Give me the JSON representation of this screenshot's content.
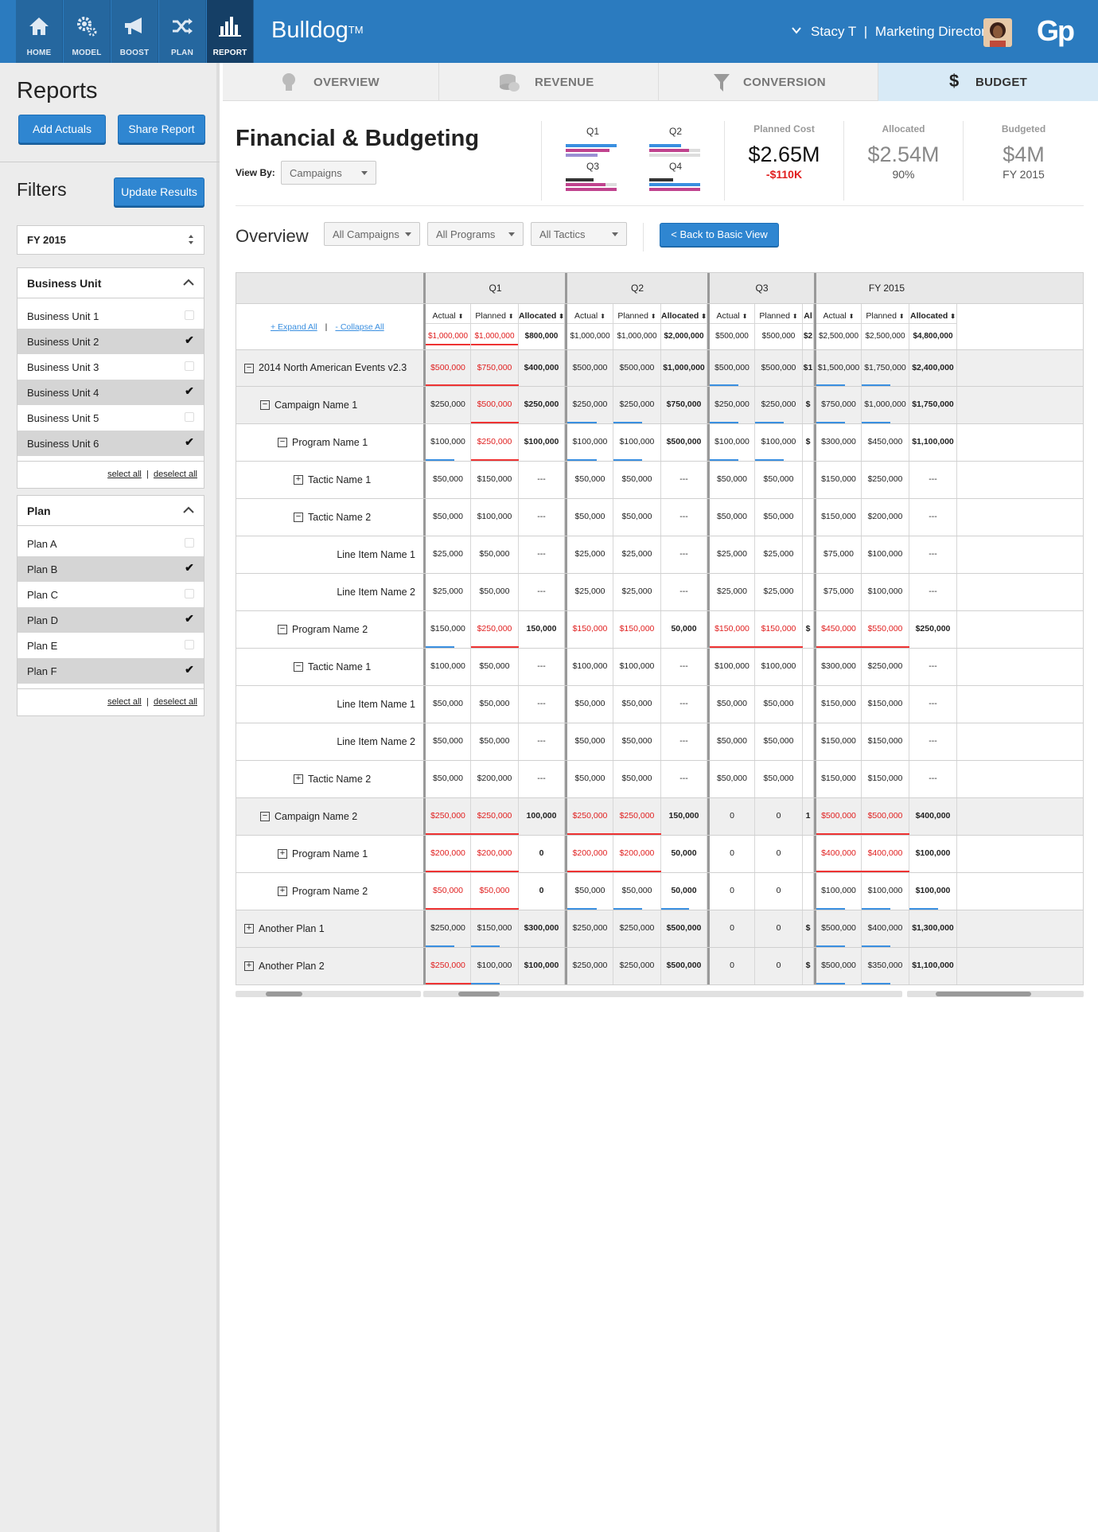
{
  "nav": {
    "items": [
      {
        "label": "HOME",
        "icon": "home-icon"
      },
      {
        "label": "MODEL",
        "icon": "gears-icon"
      },
      {
        "label": "BOOST",
        "icon": "megaphone-icon"
      },
      {
        "label": "PLAN",
        "icon": "shuffle-icon"
      },
      {
        "label": "REPORT",
        "icon": "bar-chart-icon",
        "active": true
      }
    ],
    "brand": "Bulldog",
    "brand_mark": "TM",
    "user_name": "Stacy T",
    "user_sep": "|",
    "user_role": "Marketing Director",
    "logo": "Gp"
  },
  "sidebar": {
    "reports_title": "Reports",
    "add_actuals": "Add Actuals",
    "share_report": "Share Report",
    "filters_title": "Filters",
    "update_results": "Update Results",
    "fiscal_year": "FY 2015",
    "business_unit": {
      "title": "Business Unit",
      "items": [
        {
          "label": "Business Unit 1",
          "checked": false
        },
        {
          "label": "Business Unit 2",
          "checked": true
        },
        {
          "label": "Business Unit 3",
          "checked": false
        },
        {
          "label": "Business Unit 4",
          "checked": true
        },
        {
          "label": "Business Unit 5",
          "checked": false
        },
        {
          "label": "Business Unit 6",
          "checked": true
        }
      ],
      "select_all": "select all",
      "deselect_all": "deselect all"
    },
    "plan": {
      "title": "Plan",
      "items": [
        {
          "label": "Plan A",
          "checked": false
        },
        {
          "label": "Plan B",
          "checked": true
        },
        {
          "label": "Plan C",
          "checked": false
        },
        {
          "label": "Plan D",
          "checked": true
        },
        {
          "label": "Plan E",
          "checked": false
        },
        {
          "label": "Plan F",
          "checked": true
        }
      ],
      "select_all": "select all",
      "deselect_all": "deselect all"
    }
  },
  "tabs": [
    {
      "label": "OVERVIEW",
      "icon": "lightbulb-icon"
    },
    {
      "label": "REVENUE",
      "icon": "coins-icon"
    },
    {
      "label": "CONVERSION",
      "icon": "funnel-icon"
    },
    {
      "label": "BUDGET",
      "icon": "dollar-icon",
      "active": true
    }
  ],
  "header": {
    "title": "Financial & Budgeting",
    "view_by_label": "View By:",
    "view_by_value": "Campaigns",
    "quarters": [
      "Q1",
      "Q2",
      "Q3",
      "Q4"
    ],
    "kpis": [
      {
        "label": "Planned Cost",
        "value": "$2.65M",
        "sub": "-$110K"
      },
      {
        "label": "Allocated",
        "value": "$2.54M",
        "sub": "90%"
      },
      {
        "label": "Budgeted",
        "value": "$4M",
        "sub": "FY 2015"
      }
    ]
  },
  "overview": {
    "title": "Overview",
    "campaigns": "All Campaigns",
    "programs": "All Programs",
    "tactics": "All Tactics",
    "back_button": "< Back to Basic View"
  },
  "table": {
    "expand_all": "+ Expand All",
    "collapse_all": "- Collapse All",
    "sep": "|",
    "groups": [
      "Q1",
      "Q2",
      "Q3",
      "FY 2015"
    ],
    "cols": [
      "Actual",
      "Planned",
      "Allocated",
      "Actual",
      "Planned",
      "Allocated",
      "Actual",
      "Planned",
      "Al",
      "Actual",
      "Planned",
      "Allocated"
    ],
    "totals": [
      "$1,000,000",
      "$1,000,000",
      "$800,000",
      "$1,000,000",
      "$1,000,000",
      "$2,000,000",
      "$500,000",
      "$500,000",
      "$2",
      "$2,500,000",
      "$2,500,000",
      "$4,800,000"
    ],
    "rows": [
      {
        "name": "2014 North American Events v2.3",
        "level": 0,
        "toggle": "−",
        "vals": [
          "$500,000",
          "$750,000",
          "$400,000",
          "$500,000",
          "$500,000",
          "$1,000,000",
          "$500,000",
          "$500,000",
          "$1",
          "$1,500,000",
          "$1,750,000",
          "$2,400,000"
        ]
      },
      {
        "name": "Campaign Name 1",
        "level": 1,
        "toggle": "−",
        "vals": [
          "$250,000",
          "$500,000",
          "$250,000",
          "$250,000",
          "$250,000",
          "$750,000",
          "$250,000",
          "$250,000",
          "$",
          "$750,000",
          "$1,000,000",
          "$1,750,000"
        ]
      },
      {
        "name": "Program Name 1",
        "level": 2,
        "toggle": "−",
        "vals": [
          "$100,000",
          "$250,000",
          "$100,000",
          "$100,000",
          "$100,000",
          "$500,000",
          "$100,000",
          "$100,000",
          "$",
          "$300,000",
          "$450,000",
          "$1,100,000"
        ]
      },
      {
        "name": "Tactic Name 1",
        "level": 3,
        "toggle": "+",
        "vals": [
          "$50,000",
          "$150,000",
          "---",
          "$50,000",
          "$50,000",
          "---",
          "$50,000",
          "$50,000",
          "",
          "$150,000",
          "$250,000",
          "---"
        ]
      },
      {
        "name": "Tactic Name 2",
        "level": 3,
        "toggle": "−",
        "vals": [
          "$50,000",
          "$100,000",
          "---",
          "$50,000",
          "$50,000",
          "---",
          "$50,000",
          "$50,000",
          "",
          "$150,000",
          "$200,000",
          "---"
        ]
      },
      {
        "name": "Line Item Name 1",
        "level": 4,
        "toggle": "",
        "vals": [
          "$25,000",
          "$50,000",
          "---",
          "$25,000",
          "$25,000",
          "---",
          "$25,000",
          "$25,000",
          "",
          "$75,000",
          "$100,000",
          "---"
        ]
      },
      {
        "name": "Line Item Name 2",
        "level": 4,
        "toggle": "",
        "vals": [
          "$25,000",
          "$50,000",
          "---",
          "$25,000",
          "$25,000",
          "---",
          "$25,000",
          "$25,000",
          "",
          "$75,000",
          "$100,000",
          "---"
        ]
      },
      {
        "name": "Program Name 2",
        "level": 2,
        "toggle": "−",
        "vals": [
          "$150,000",
          "$250,000",
          "150,000",
          "$150,000",
          "$150,000",
          "50,000",
          "$150,000",
          "$150,000",
          "$",
          "$450,000",
          "$550,000",
          "$250,000"
        ]
      },
      {
        "name": "Tactic Name 1",
        "level": 3,
        "toggle": "−",
        "vals": [
          "$100,000",
          "$50,000",
          "---",
          "$100,000",
          "$100,000",
          "---",
          "$100,000",
          "$100,000",
          "",
          "$300,000",
          "$250,000",
          "---"
        ]
      },
      {
        "name": "Line Item Name 1",
        "level": 4,
        "toggle": "",
        "vals": [
          "$50,000",
          "$50,000",
          "---",
          "$50,000",
          "$50,000",
          "---",
          "$50,000",
          "$50,000",
          "",
          "$150,000",
          "$150,000",
          "---"
        ]
      },
      {
        "name": "Line Item Name 2",
        "level": 4,
        "toggle": "",
        "vals": [
          "$50,000",
          "$50,000",
          "---",
          "$50,000",
          "$50,000",
          "---",
          "$50,000",
          "$50,000",
          "",
          "$150,000",
          "$150,000",
          "---"
        ]
      },
      {
        "name": "Tactic Name 2",
        "level": 3,
        "toggle": "+",
        "vals": [
          "$50,000",
          "$200,000",
          "---",
          "$50,000",
          "$50,000",
          "---",
          "$50,000",
          "$50,000",
          "",
          "$150,000",
          "$150,000",
          "---"
        ]
      },
      {
        "name": "Campaign Name 2",
        "level": 1,
        "toggle": "−",
        "vals": [
          "$250,000",
          "$250,000",
          "100,000",
          "$250,000",
          "$250,000",
          "150,000",
          "0",
          "0",
          "1",
          "$500,000",
          "$500,000",
          "$400,000"
        ]
      },
      {
        "name": "Program Name 1",
        "level": 2,
        "toggle": "+",
        "vals": [
          "$200,000",
          "$200,000",
          "0",
          "$200,000",
          "$200,000",
          "50,000",
          "0",
          "0",
          "",
          "$400,000",
          "$400,000",
          "$100,000"
        ]
      },
      {
        "name": "Program Name 2",
        "level": 2,
        "toggle": "+",
        "vals": [
          "$50,000",
          "$50,000",
          "0",
          "$50,000",
          "$50,000",
          "50,000",
          "0",
          "0",
          "",
          "$100,000",
          "$100,000",
          "$100,000"
        ]
      },
      {
        "name": "Another Plan 1",
        "level": 0,
        "toggle": "+",
        "vals": [
          "$250,000",
          "$150,000",
          "$300,000",
          "$250,000",
          "$250,000",
          "$500,000",
          "0",
          "0",
          "$",
          "$500,000",
          "$400,000",
          "$1,300,000"
        ]
      },
      {
        "name": "Another Plan 2",
        "level": 0,
        "toggle": "+",
        "vals": [
          "$250,000",
          "$100,000",
          "$100,000",
          "$250,000",
          "$250,000",
          "$500,000",
          "0",
          "0",
          "$",
          "$500,000",
          "$350,000",
          "$1,100,000"
        ]
      }
    ]
  },
  "colors": {
    "nav_bg": "#2b7bbf",
    "nav_active": "#153f66",
    "accent_blue": "#2f86d1",
    "over_budget_red": "#e01e1e",
    "bar_blue": "#3a8fe0",
    "bar_pink": "#c0438e",
    "tab_active": "#d8eaf6"
  }
}
